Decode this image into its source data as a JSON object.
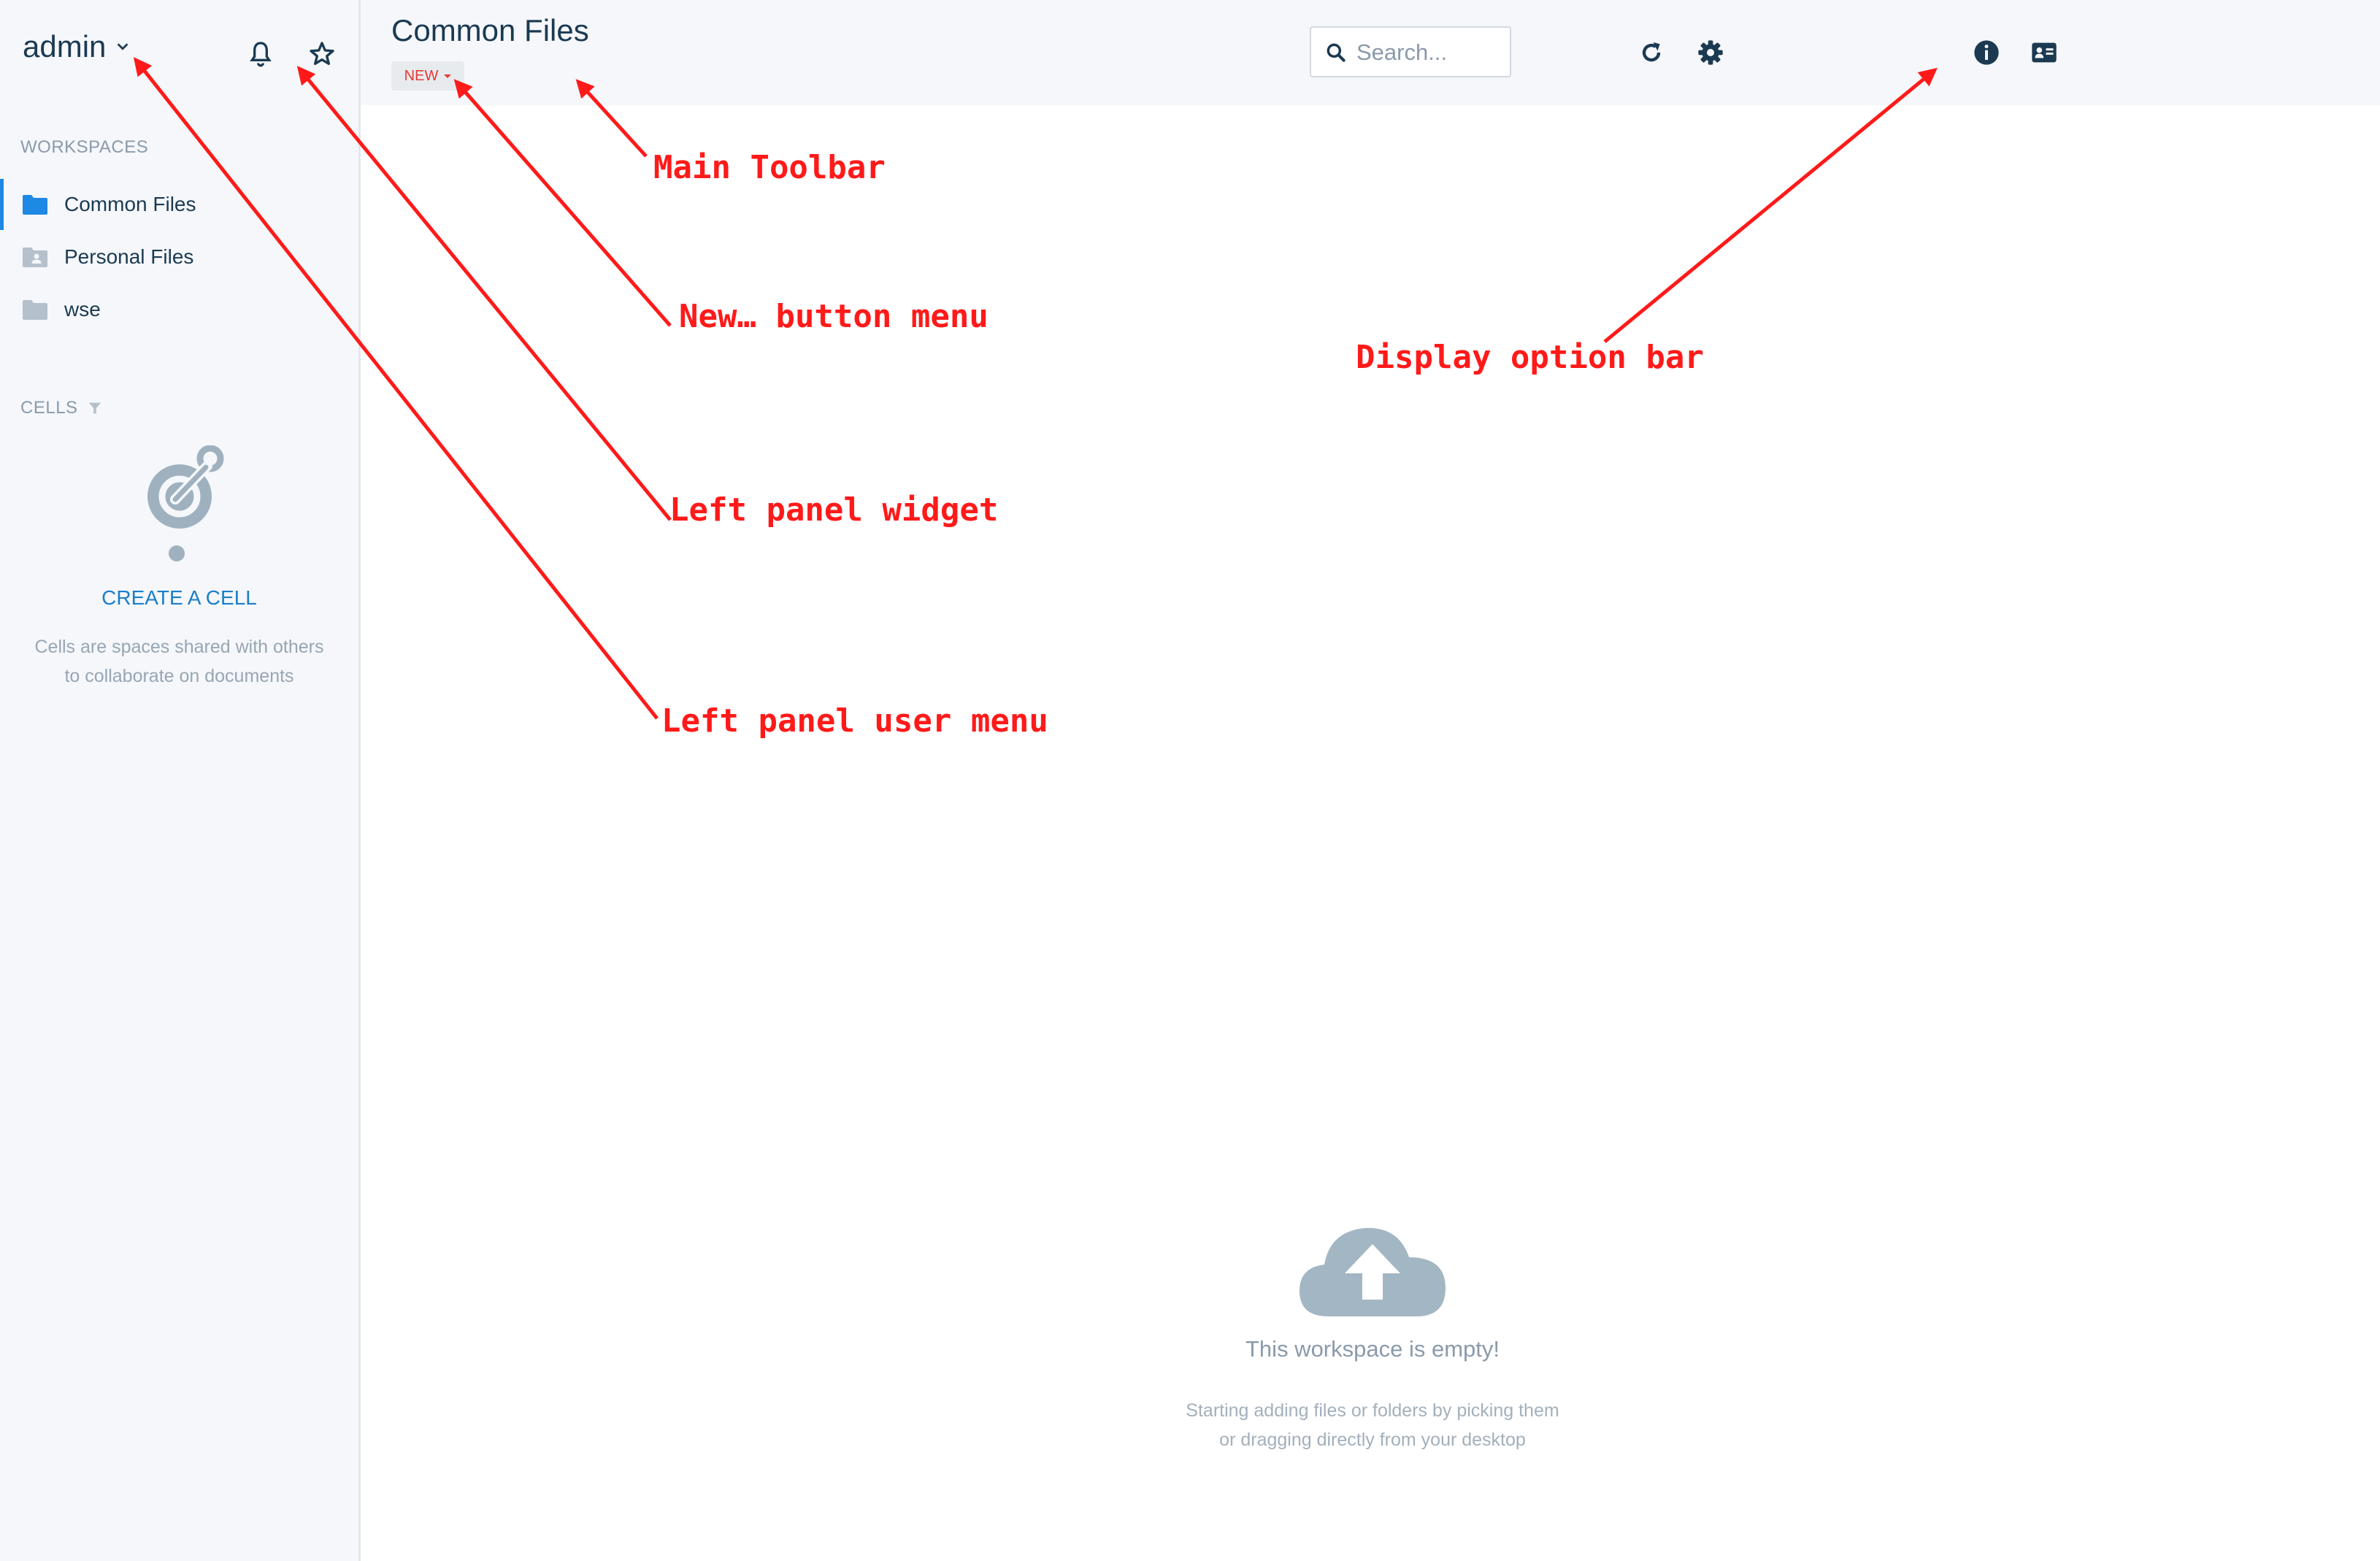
{
  "sidebar": {
    "user_name": "admin",
    "workspaces_title": "WORKSPACES",
    "workspaces": [
      {
        "label": "Common Files",
        "icon": "folder-icon",
        "active": true
      },
      {
        "label": "Personal Files",
        "icon": "personal-folder-icon",
        "active": false
      },
      {
        "label": "wse",
        "icon": "folder-icon",
        "active": false
      }
    ],
    "cells_title": "CELLS",
    "cells_action": "CREATE A CELL",
    "cells_desc_line1": "Cells are spaces shared with others",
    "cells_desc_line2": "to collaborate on documents"
  },
  "toolbar": {
    "title": "Common Files",
    "new_label": "NEW",
    "search_placeholder": "Search..."
  },
  "empty_state": {
    "title": "This workspace is empty!",
    "desc_line1": "Starting adding files or folders by picking them",
    "desc_line2": "or dragging directly from your desktop"
  },
  "annotations": [
    {
      "label": "Main Toolbar"
    },
    {
      "label": "New… button menu"
    },
    {
      "label": "Display option bar"
    },
    {
      "label": "Left panel widget"
    },
    {
      "label": "Left panel user menu"
    }
  ],
  "colors": {
    "accent": "#1e88e5",
    "link": "#1a7ec8",
    "annotation": "#ff1a1a",
    "text_dark": "#1b3a52",
    "text_muted": "#8a9aab"
  }
}
